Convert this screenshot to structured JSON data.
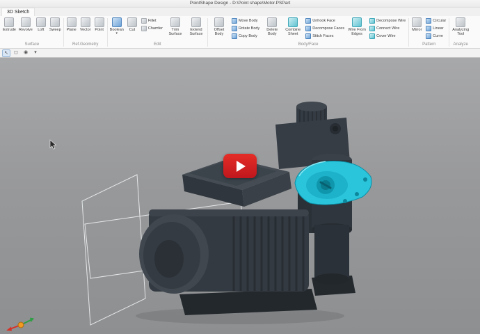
{
  "window": {
    "title": "PointShape Design - D:\\Point shape\\Motor.PSPart"
  },
  "tabs": {
    "active": "3D Sketch"
  },
  "icons": {
    "dropdown": "▾",
    "select": "↖",
    "zoom_window": "◻",
    "orbit": "◉"
  },
  "ribbon": {
    "groups": [
      {
        "label": "Surface",
        "items": [
          {
            "label": "Extrude"
          },
          {
            "label": "Revolve"
          },
          {
            "label": "Loft"
          },
          {
            "label": "Sweep"
          }
        ]
      },
      {
        "label": "Ref.Geometry",
        "items": [
          {
            "label": "Plane"
          },
          {
            "label": "Vector"
          },
          {
            "label": "Point"
          }
        ]
      },
      {
        "label": "Edit",
        "items": [
          {
            "label": "Boolean"
          },
          {
            "label": "Cut"
          },
          {
            "label": "Fillet"
          },
          {
            "label": "Chamfer"
          },
          {
            "label": "Trim Surface"
          },
          {
            "label": "Extend Surface"
          }
        ]
      },
      {
        "label": "Body/Face",
        "items": [
          {
            "label": "Offset Body"
          },
          {
            "label": "Move Body"
          },
          {
            "label": "Rotate Body"
          },
          {
            "label": "Copy Body"
          },
          {
            "label": "Delete Body"
          },
          {
            "label": "Combine Sheet"
          },
          {
            "label": "Unhook Face"
          },
          {
            "label": "Decompose Faces"
          },
          {
            "label": "Stitch Faces"
          },
          {
            "label": "Wire From Edges"
          },
          {
            "label": "Decompose Wire"
          },
          {
            "label": "Connect Wire"
          },
          {
            "label": "Cover Wire"
          }
        ]
      },
      {
        "label": "Pattern",
        "items": [
          {
            "label": "Mirror"
          },
          {
            "label": "Circular"
          },
          {
            "label": "Linear"
          },
          {
            "label": "Curve"
          }
        ]
      },
      {
        "label": "Analyze",
        "items": [
          {
            "label": "Analyzing Tool"
          }
        ]
      }
    ]
  },
  "viewport": {
    "selection_color": "#2ac4db",
    "play_button_color": "#e52d27"
  }
}
